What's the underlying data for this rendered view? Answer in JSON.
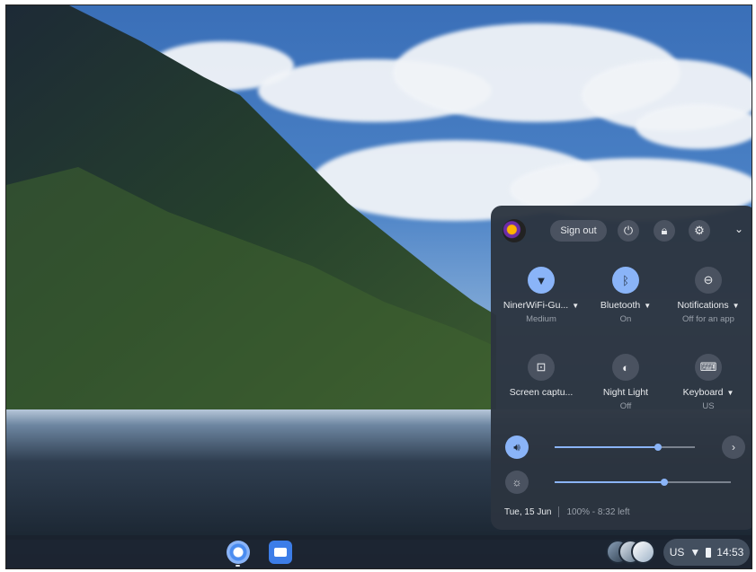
{
  "system_tray": {
    "user": {
      "sign_out_label": "Sign out"
    },
    "top_icons": [
      "power-icon",
      "lock-icon",
      "gear-icon",
      "chevron-down-icon"
    ],
    "tiles": [
      {
        "icon": "wifi-icon",
        "label": "NinerWiFi-Gu...",
        "status": "Medium",
        "active": true,
        "dropdown": true
      },
      {
        "icon": "bluetooth-icon",
        "label": "Bluetooth",
        "status": "On",
        "active": true,
        "dropdown": true
      },
      {
        "icon": "notifications-icon",
        "label": "Notifications",
        "status": "Off for an app",
        "active": false,
        "dropdown": true
      },
      {
        "icon": "screen-capture-icon",
        "label": "Screen captu...",
        "status": "",
        "active": false,
        "dropdown": false
      },
      {
        "icon": "night-light-icon",
        "label": "Night Light",
        "status": "Off",
        "active": false,
        "dropdown": false
      },
      {
        "icon": "keyboard-icon",
        "label": "Keyboard",
        "status": "US",
        "active": false,
        "dropdown": true
      }
    ],
    "sliders": {
      "volume": {
        "icon": "volume-icon",
        "level": 0.74
      },
      "brightness": {
        "icon": "brightness-icon",
        "level": 0.62
      }
    },
    "footer": {
      "date": "Tue, 15 Jun",
      "battery": "100% - 8:32 left"
    }
  },
  "shelf": {
    "apps": [
      "chrome-icon",
      "files-icon"
    ],
    "status_area": {
      "input_method": "US",
      "time": "14:53"
    }
  },
  "colors": {
    "accent": "#8ab4f8",
    "panel_bg": "#2c3440",
    "shelf_bg": "#1a222e"
  }
}
